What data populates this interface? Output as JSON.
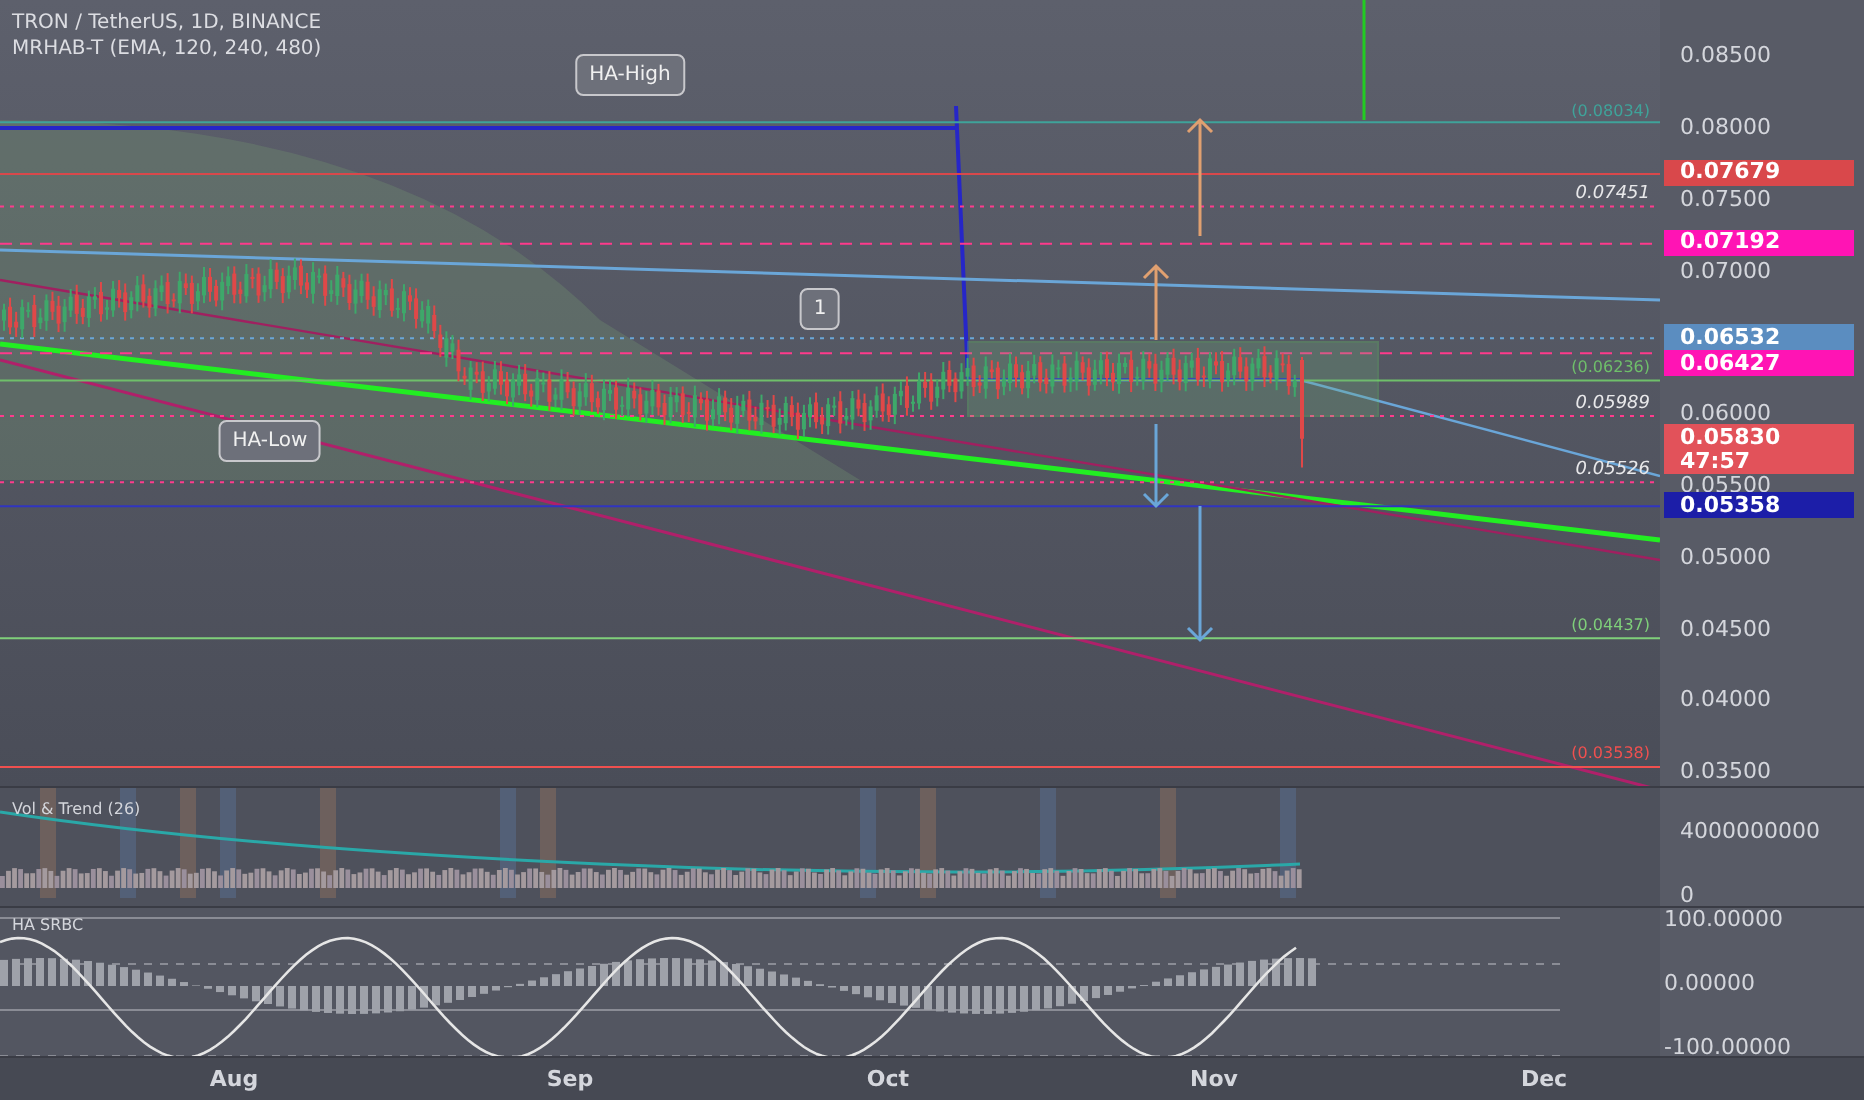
{
  "header": {
    "title": "TRON / TetherUS, 1D, BINANCE",
    "indicator": "MRHAB-T (EMA, 120, 240, 480)"
  },
  "price_axis": [
    "0.08500",
    "0.08000",
    "0.07500",
    "0.07000",
    "0.06000",
    "0.05500",
    "0.05000",
    "0.04500",
    "0.04000",
    "0.03500"
  ],
  "price_badges": [
    {
      "value": "0.07679",
      "color": "#d9484b"
    },
    {
      "value": "0.07192",
      "color": "#ff14b4"
    },
    {
      "value": "0.06532",
      "color": "#5b8dc0"
    },
    {
      "value": "0.06427",
      "color": "#ff14b4"
    },
    {
      "value": "0.05830",
      "countdown": "47:57",
      "color": "#e2525a"
    },
    {
      "value": "0.05358",
      "color": "#1c1ea8"
    }
  ],
  "line_labels": [
    {
      "text": "(0.08034)",
      "kind": "fib",
      "color": "#3fa39a"
    },
    {
      "text": "0.07451",
      "kind": "level",
      "color": "#e8e8ea"
    },
    {
      "text": "(0.06236)",
      "kind": "fib",
      "color": "#6fbf6a"
    },
    {
      "text": "0.05989",
      "kind": "level",
      "color": "#e8e8ea"
    },
    {
      "text": "0.05526",
      "kind": "level",
      "color": "#e8e8ea"
    },
    {
      "text": "(0.04437)",
      "kind": "fib",
      "color": "#7fcf7a"
    },
    {
      "text": "(0.03538)",
      "kind": "fib",
      "color": "#f0504f"
    }
  ],
  "callouts": [
    "HA-High",
    "HA-Low",
    "1"
  ],
  "volume_pane": {
    "title": "Vol & Trend (26)",
    "axis": [
      "4000000000",
      "0"
    ]
  },
  "oscillator_pane": {
    "title": "HA SRBC",
    "axis": [
      "100.00000",
      "0.00000",
      "-100.00000"
    ]
  },
  "time_axis": [
    "Aug",
    "Sep",
    "Oct",
    "Nov",
    "Dec"
  ]
}
